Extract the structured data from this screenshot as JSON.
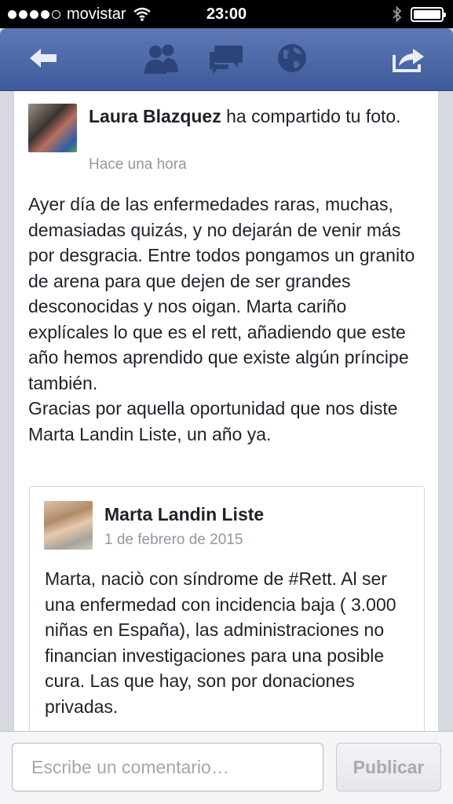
{
  "status_bar": {
    "carrier": "movistar",
    "time": "23:00"
  },
  "nav": {
    "icons": [
      "back-icon",
      "friends-icon",
      "messages-icon",
      "globe-icon",
      "share-icon"
    ],
    "color": "#4a66a8"
  },
  "story": {
    "actor": "Laura Blazquez",
    "action": " ha compartido tu foto.",
    "time": "Hace una hora",
    "text": "Ayer día de las enfermedades raras, muchas, demasiadas quizás, y no dejarán de venir más por desgracia. Entre todos pongamos un granito de arena para que dejen de ser grandes desconocidas y nos oigan. Marta cariño explícales lo que es el rett, añadiendo que este año hemos aprendido que existe algún príncipe también.\nGracias por aquella oportunidad que nos diste Marta Landin Liste, un año ya."
  },
  "shared_post": {
    "author": "Marta Landin Liste",
    "date": "1 de febrero de 2015",
    "text": "Marta, naciò con síndrome de #Rett. Al ser una enfermedad con incidencia baja ( 3.000 niñas en España), las administraciones no financian investigaciones para una posible cura. Las que hay, son por donaciones privadas."
  },
  "composer": {
    "placeholder": "Escribe un comentario…",
    "publish_label": "Publicar"
  }
}
